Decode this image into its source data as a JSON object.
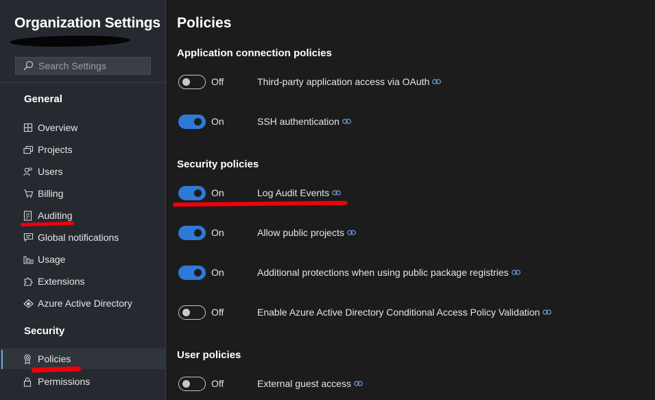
{
  "sidebar": {
    "org_title": "Organization Settings",
    "search_placeholder": "Search Settings",
    "sections": [
      {
        "title": "General",
        "items": [
          {
            "label": "Overview",
            "icon": "overview-icon"
          },
          {
            "label": "Projects",
            "icon": "projects-icon"
          },
          {
            "label": "Users",
            "icon": "users-icon"
          },
          {
            "label": "Billing",
            "icon": "billing-cart-icon"
          },
          {
            "label": "Auditing",
            "icon": "auditing-icon"
          },
          {
            "label": "Global notifications",
            "icon": "notifications-icon"
          },
          {
            "label": "Usage",
            "icon": "usage-chart-icon"
          },
          {
            "label": "Extensions",
            "icon": "extensions-puzzle-icon"
          },
          {
            "label": "Azure Active Directory",
            "icon": "azure-ad-icon"
          }
        ]
      },
      {
        "title": "Security",
        "items": [
          {
            "label": "Policies",
            "icon": "policies-badge-icon",
            "selected": true
          },
          {
            "label": "Permissions",
            "icon": "lock-icon"
          }
        ]
      }
    ]
  },
  "main": {
    "title": "Policies",
    "groups": [
      {
        "title": "Application connection policies",
        "policies": [
          {
            "state": "Off",
            "label": "Third-party application access via OAuth"
          },
          {
            "state": "On",
            "label": "SSH authentication"
          }
        ]
      },
      {
        "title": "Security policies",
        "policies": [
          {
            "state": "On",
            "label": "Log Audit Events"
          },
          {
            "state": "On",
            "label": "Allow public projects"
          },
          {
            "state": "On",
            "label": "Additional protections when using public package registries"
          },
          {
            "state": "Off",
            "label": "Enable Azure Active Directory Conditional Access Policy Validation"
          }
        ]
      },
      {
        "title": "User policies",
        "policies": [
          {
            "state": "Off",
            "label": "External guest access"
          }
        ]
      }
    ]
  },
  "colors": {
    "toggle_on": "#2d7ad6",
    "annotation_red": "#f0000a",
    "selected_indicator": "#6aa9e9"
  }
}
